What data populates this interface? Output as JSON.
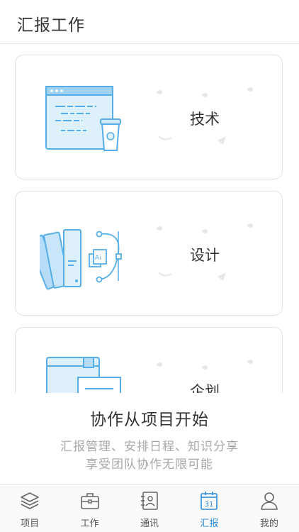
{
  "header": {
    "title": "汇报工作"
  },
  "categories": [
    {
      "label": "技术",
      "icon": "code-window-coffee-icon"
    },
    {
      "label": "设计",
      "icon": "color-swatch-pen-icon"
    },
    {
      "label": "企划",
      "icon": "document-books-icon"
    }
  ],
  "promo": {
    "headline": "协作从项目开始",
    "desc_line1": "汇报管理、安排日程、知识分享",
    "desc_line2": "享受团队协作无限可能"
  },
  "tabbar": {
    "items": [
      {
        "label": "项目",
        "icon": "layers-icon",
        "active": false
      },
      {
        "label": "工作",
        "icon": "briefcase-icon",
        "active": false
      },
      {
        "label": "通讯",
        "icon": "contacts-book-icon",
        "active": false
      },
      {
        "label": "汇报",
        "icon": "calendar-icon",
        "active": true,
        "badge": "31"
      },
      {
        "label": "我的",
        "icon": "person-icon",
        "active": false
      }
    ]
  },
  "colors": {
    "accent": "#2a8ad8",
    "illus_fill": "#d8ecfb",
    "illus_stroke": "#56aee8",
    "muted_text": "#a8a8a8"
  }
}
